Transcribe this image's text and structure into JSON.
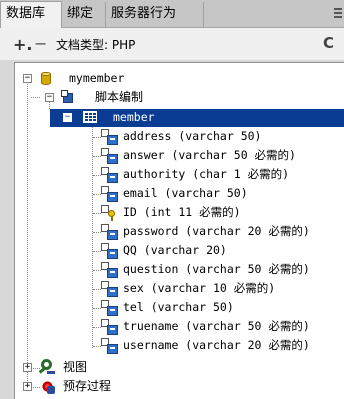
{
  "tabs": [
    {
      "label": "数据库",
      "active": true
    },
    {
      "label": "绑定",
      "active": false
    },
    {
      "label": "服务器行为",
      "active": false
    }
  ],
  "toolbar": {
    "add_label": "+.",
    "remove_label": "−",
    "doctype": "文档类型: PHP",
    "refresh_label": "C"
  },
  "tree": {
    "database": {
      "name": "mymember",
      "expanded_symbol": "−"
    },
    "script": {
      "name": "脚本编制",
      "expanded_symbol": "−"
    },
    "table": {
      "name": "member",
      "expanded_symbol": "−",
      "selected": true
    },
    "columns": [
      {
        "label": "address (varchar 50)",
        "key": false
      },
      {
        "label": "answer (varchar 50 必需的)",
        "key": false
      },
      {
        "label": "authority (char 1 必需的)",
        "key": false
      },
      {
        "label": "email (varchar 50)",
        "key": false
      },
      {
        "label": "ID (int 11 必需的)",
        "key": true
      },
      {
        "label": "password (varchar 20 必需的)",
        "key": false
      },
      {
        "label": "QQ (varchar 20)",
        "key": false
      },
      {
        "label": "question (varchar 50 必需的)",
        "key": false
      },
      {
        "label": "sex (varchar 10 必需的)",
        "key": false
      },
      {
        "label": "tel (varchar 50)",
        "key": false
      },
      {
        "label": "truename (varchar 50 必需的)",
        "key": false
      },
      {
        "label": "username (varchar 20 必需的)",
        "key": false
      }
    ],
    "views": {
      "name": "视图",
      "collapsed_symbol": "+"
    },
    "procedures": {
      "name": "预存过程",
      "collapsed_symbol": "+"
    }
  },
  "colors": {
    "selection": "#0a3c94",
    "panel_bg": "#ffffff",
    "chrome_bg": "#f0f0f0"
  }
}
